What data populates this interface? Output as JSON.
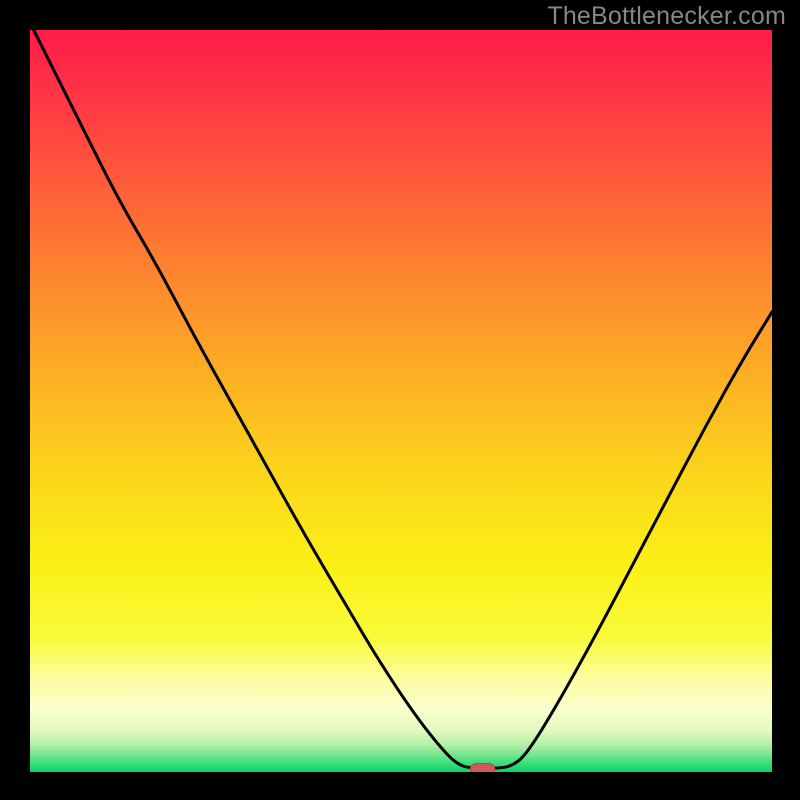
{
  "watermark": "TheBottlenecker.com",
  "chart_data": {
    "type": "line",
    "title": "",
    "xlabel": "",
    "ylabel": "",
    "xlim": [
      0,
      100
    ],
    "ylim": [
      0,
      100
    ],
    "gradient_stops": [
      {
        "offset": 0.0,
        "color": "#ff1b49"
      },
      {
        "offset": 0.1,
        "color": "#ff3944"
      },
      {
        "offset": 0.22,
        "color": "#fe6138"
      },
      {
        "offset": 0.35,
        "color": "#fd8c2d"
      },
      {
        "offset": 0.48,
        "color": "#fcb322"
      },
      {
        "offset": 0.6,
        "color": "#fbd61b"
      },
      {
        "offset": 0.72,
        "color": "#faf015"
      },
      {
        "offset": 0.82,
        "color": "#f9fb3b"
      },
      {
        "offset": 0.875,
        "color": "#fcfda1"
      },
      {
        "offset": 0.915,
        "color": "#fbfece"
      },
      {
        "offset": 0.945,
        "color": "#e0f9bf"
      },
      {
        "offset": 0.965,
        "color": "#aeefa4"
      },
      {
        "offset": 0.985,
        "color": "#4be080"
      },
      {
        "offset": 1.0,
        "color": "#07d568"
      }
    ],
    "curve": [
      {
        "x": 0.0,
        "y": 101.0
      },
      {
        "x": 3.0,
        "y": 95.0
      },
      {
        "x": 7.0,
        "y": 87.0
      },
      {
        "x": 12.0,
        "y": 77.0
      },
      {
        "x": 17.0,
        "y": 68.5
      },
      {
        "x": 22.0,
        "y": 59.0
      },
      {
        "x": 27.0,
        "y": 50.0
      },
      {
        "x": 32.0,
        "y": 41.0
      },
      {
        "x": 37.0,
        "y": 32.0
      },
      {
        "x": 42.0,
        "y": 23.5
      },
      {
        "x": 47.0,
        "y": 15.0
      },
      {
        "x": 52.0,
        "y": 7.5
      },
      {
        "x": 56.0,
        "y": 2.5
      },
      {
        "x": 58.0,
        "y": 0.8
      },
      {
        "x": 60.0,
        "y": 0.5
      },
      {
        "x": 63.0,
        "y": 0.5
      },
      {
        "x": 65.0,
        "y": 0.8
      },
      {
        "x": 67.0,
        "y": 2.5
      },
      {
        "x": 71.0,
        "y": 9.0
      },
      {
        "x": 76.0,
        "y": 18.0
      },
      {
        "x": 81.0,
        "y": 27.5
      },
      {
        "x": 86.0,
        "y": 37.0
      },
      {
        "x": 91.0,
        "y": 46.5
      },
      {
        "x": 96.0,
        "y": 55.5
      },
      {
        "x": 100.0,
        "y": 62.0
      }
    ],
    "marker": {
      "x": 61.0,
      "y": 0.4,
      "w_pct": 3.3,
      "h_pct": 1.5,
      "fill": "#cf5858",
      "stroke": "#b44a4a"
    }
  }
}
